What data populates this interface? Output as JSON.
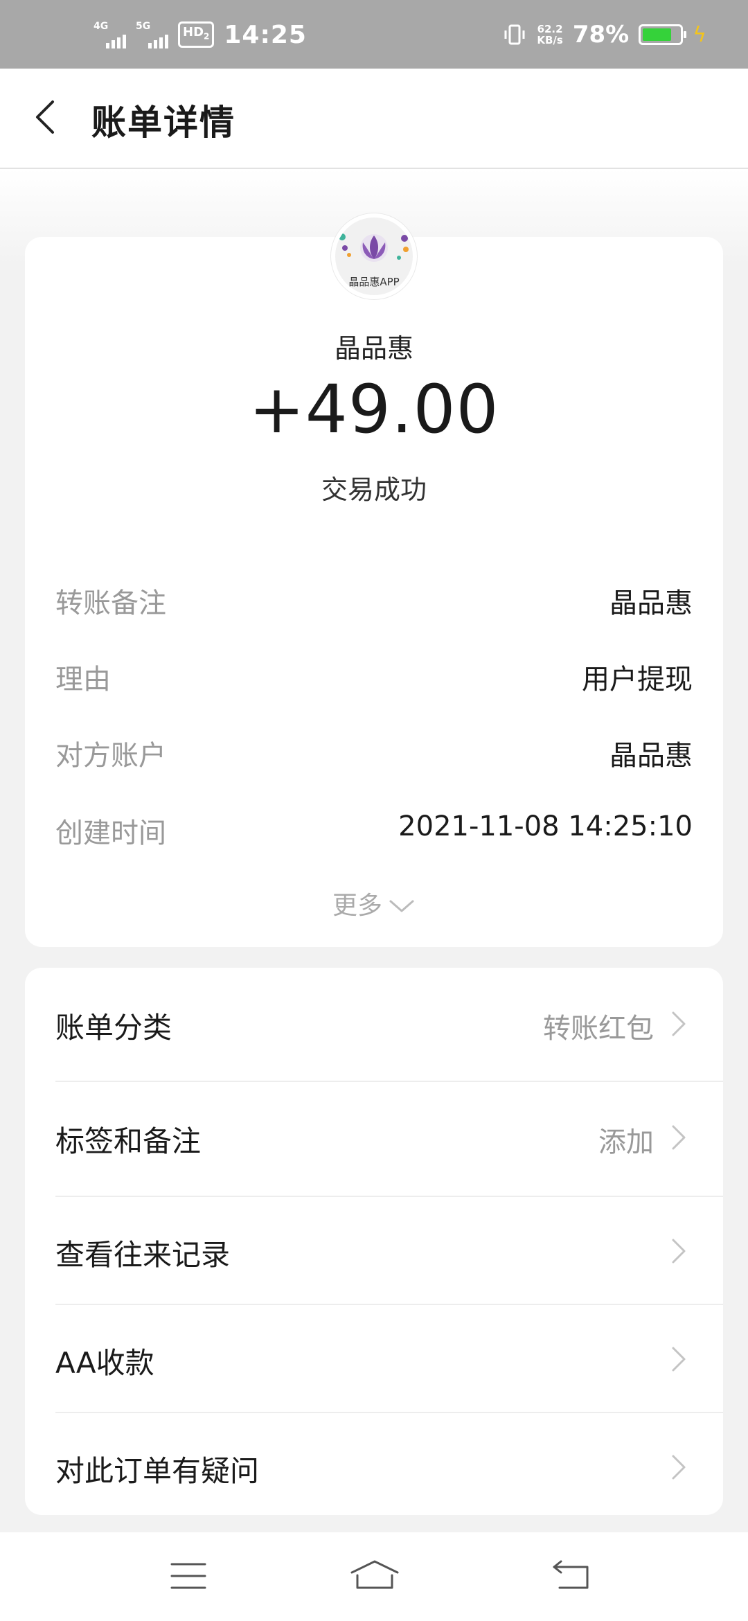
{
  "status_bar": {
    "net1": "4G",
    "net2": "5G",
    "hd": "HD",
    "hd_sub": "2",
    "time": "14:25",
    "speed_value": "62.2",
    "speed_unit": "KB/s",
    "battery_percent": "78%",
    "battery_level": 0.78,
    "battery_color": "#35d23a"
  },
  "header": {
    "title": "账单详情",
    "back_icon": "chevron-left-icon"
  },
  "transaction": {
    "logo_text": "晶品惠APP",
    "merchant": "晶品惠",
    "amount": "+49.00",
    "status": "交易成功",
    "details": [
      {
        "key": "转账备注",
        "value": "晶品惠"
      },
      {
        "key": "理由",
        "value": "用户提现"
      },
      {
        "key": "对方账户",
        "value": "晶品惠"
      },
      {
        "key": "创建时间",
        "value": "2021-11-08 14:25:10"
      }
    ],
    "more_label": "更多"
  },
  "menu": [
    {
      "label": "账单分类",
      "value": "转账红包"
    },
    {
      "label": "标签和备注",
      "value": "添加"
    },
    {
      "label": "查看往来记录",
      "value": ""
    },
    {
      "label": "AA收款",
      "value": ""
    },
    {
      "label": "对此订单有疑问",
      "value": ""
    }
  ],
  "nav_bar": {
    "menu_icon": "menu-icon",
    "home_icon": "home-icon",
    "back_icon": "return-icon"
  }
}
